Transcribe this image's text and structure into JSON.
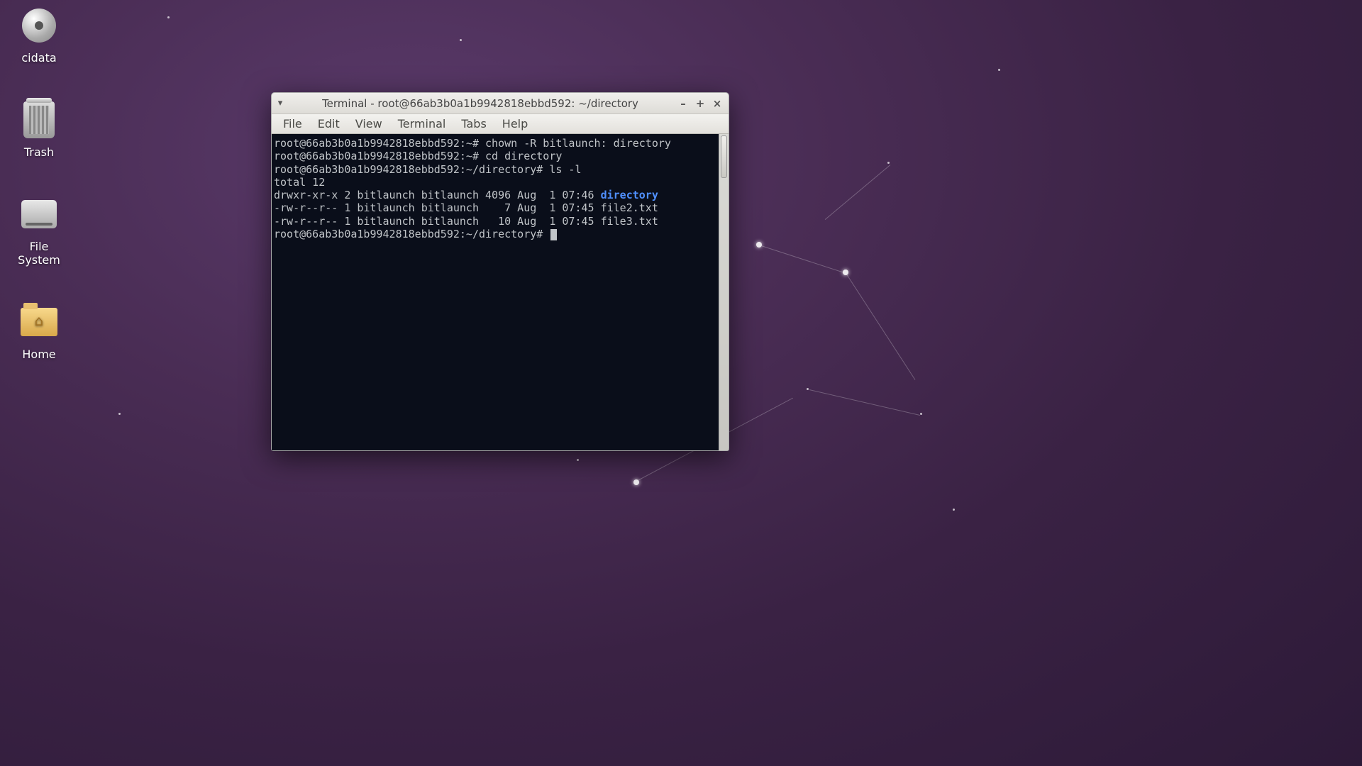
{
  "desktop": {
    "icons": [
      {
        "name": "cidata",
        "type": "disc"
      },
      {
        "name": "Trash",
        "type": "trash"
      },
      {
        "name": "File System",
        "type": "drive"
      },
      {
        "name": "Home",
        "type": "folder"
      }
    ]
  },
  "window": {
    "title": "Terminal - root@66ab3b0a1b9942818ebbd592: ~/directory",
    "menu": [
      "File",
      "Edit",
      "View",
      "Terminal",
      "Tabs",
      "Help"
    ],
    "controls": {
      "minimize": "–",
      "maximize": "+",
      "close": "×"
    }
  },
  "terminal": {
    "lines": [
      {
        "prompt": "root@66ab3b0a1b9942818ebbd592:~#",
        "cmd": " chown -R bitlaunch: directory"
      },
      {
        "prompt": "root@66ab3b0a1b9942818ebbd592:~#",
        "cmd": " cd directory"
      },
      {
        "prompt": "root@66ab3b0a1b9942818ebbd592:~/directory#",
        "cmd": " ls -l"
      },
      {
        "text": "total 12"
      },
      {
        "text": "drwxr-xr-x 2 bitlaunch bitlaunch 4096 Aug  1 07:46 ",
        "dir": "directory"
      },
      {
        "text": "-rw-r--r-- 1 bitlaunch bitlaunch    7 Aug  1 07:45 file2.txt"
      },
      {
        "text": "-rw-r--r-- 1 bitlaunch bitlaunch   10 Aug  1 07:45 file3.txt"
      },
      {
        "prompt": "root@66ab3b0a1b9942818ebbd592:~/directory#",
        "cursor": true
      }
    ]
  }
}
